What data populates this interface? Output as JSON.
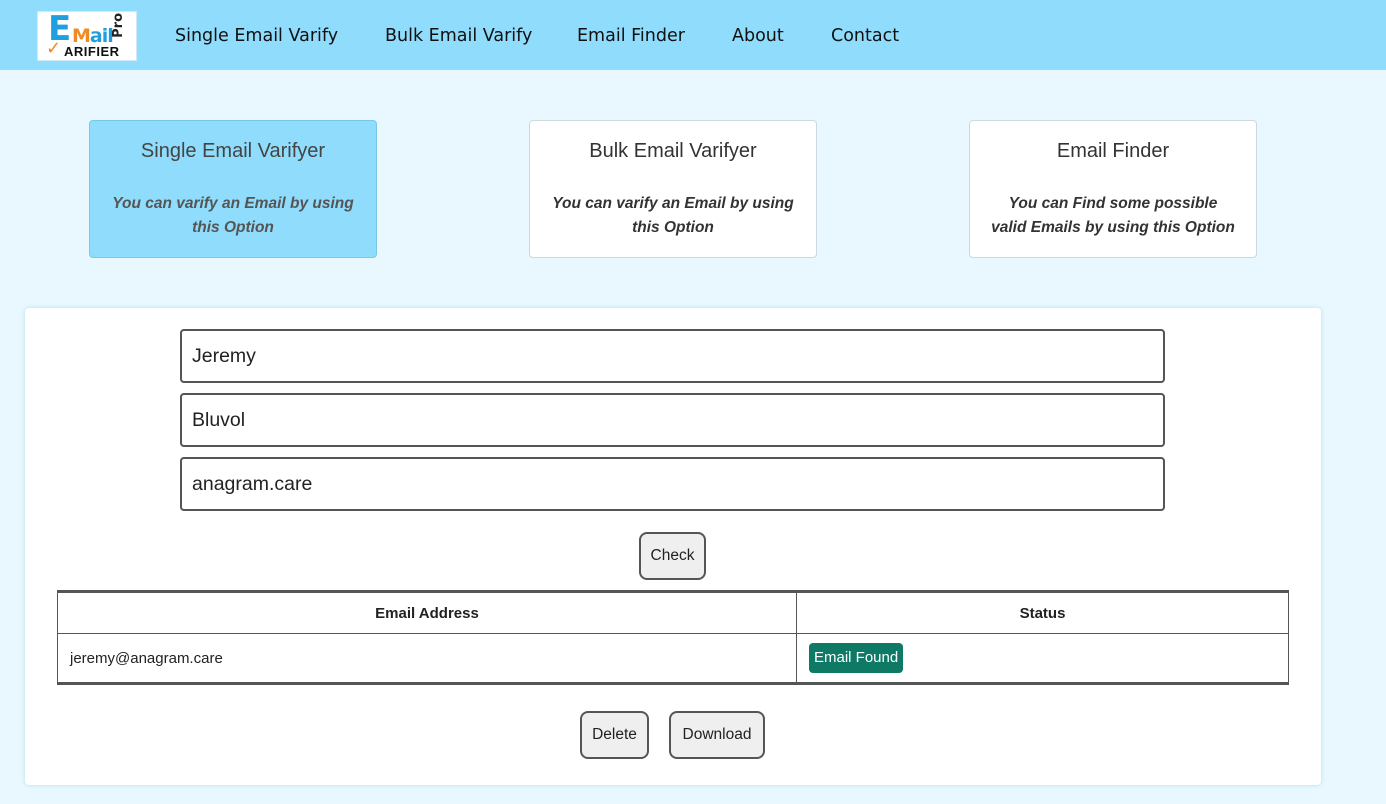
{
  "logo": {
    "e": "E",
    "mail_m": "M",
    "mail_rest": "ail",
    "pro": "Pro",
    "varifier": "ARIFIER",
    "check": "✓"
  },
  "nav": {
    "links": [
      "Single Email Varify",
      "Bulk Email Varify",
      "Email Finder",
      "About",
      "Contact"
    ]
  },
  "cards": [
    {
      "title": "Single Email Varifyer",
      "desc_line1": "You can varify an Email by using",
      "desc_line2": "this Option"
    },
    {
      "title": "Bulk Email Varifyer",
      "desc_line1": "You can varify an Email by using",
      "desc_line2": "this Option"
    },
    {
      "title": "Email Finder",
      "desc_line1": "You can Find some possible",
      "desc_line2": "valid Emails by using this Option"
    }
  ],
  "form": {
    "first_name": "Jeremy",
    "last_name": "Bluvol",
    "domain": "anagram.care",
    "check_label": "Check"
  },
  "table": {
    "headers": [
      "Email Address",
      "Status"
    ],
    "rows": [
      {
        "email": "jeremy@anagram.care",
        "status": "Email Found"
      }
    ]
  },
  "actions": {
    "delete_label": "Delete",
    "download_label": "Download"
  },
  "colors": {
    "accent": "#8fdcfc",
    "background": "#e9f8fe",
    "status_found": "#0e7a66"
  }
}
